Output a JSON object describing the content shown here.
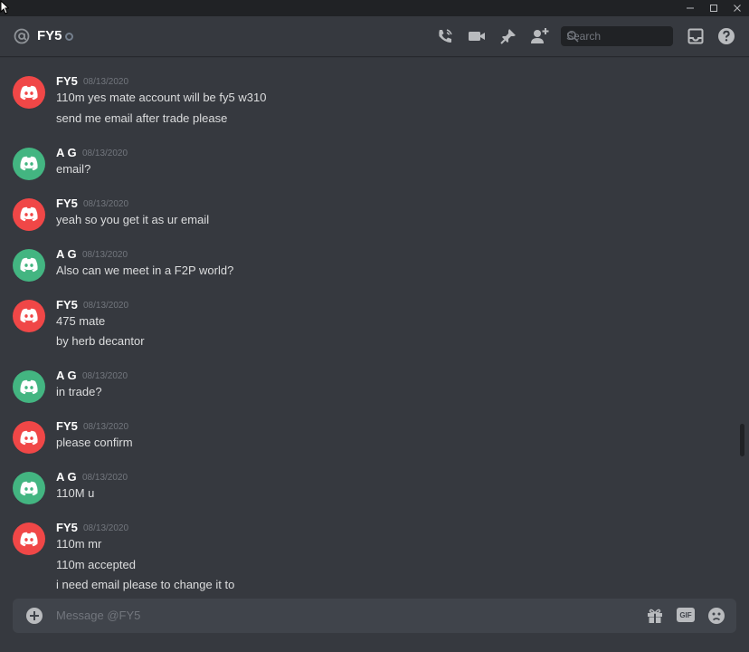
{
  "window": {
    "controls": [
      "minimize-icon",
      "maximize-icon",
      "close-icon"
    ]
  },
  "header": {
    "channel_name": "FY5",
    "status": "offline",
    "icons": [
      "call-icon",
      "video-icon",
      "pin-icon",
      "add-friend-icon",
      "inbox-icon",
      "help-icon"
    ],
    "search_placeholder": "Search"
  },
  "colors": {
    "fy5_avatar": "#f04747",
    "ag_avatar": "#43b581",
    "background": "#36393f",
    "header_text": "#ffffff"
  },
  "messages": [
    {
      "author": "FY5",
      "timestamp": "08/13/2020",
      "avatar": "red",
      "lines": [
        "110m yes mate account will be fy5 w310",
        "send me email after trade please"
      ]
    },
    {
      "author": "A G",
      "timestamp": "08/13/2020",
      "avatar": "green",
      "lines": [
        "email?"
      ]
    },
    {
      "author": "FY5",
      "timestamp": "08/13/2020",
      "avatar": "red",
      "lines": [
        "yeah so you get it as ur email"
      ]
    },
    {
      "author": "A G",
      "timestamp": "08/13/2020",
      "avatar": "green",
      "lines": [
        "Also can we meet in a F2P world?"
      ]
    },
    {
      "author": "FY5",
      "timestamp": "08/13/2020",
      "avatar": "red",
      "lines": [
        "475 mate",
        "by herb decantor"
      ]
    },
    {
      "author": "A G",
      "timestamp": "08/13/2020",
      "avatar": "green",
      "lines": [
        "in trade?"
      ]
    },
    {
      "author": "FY5",
      "timestamp": "08/13/2020",
      "avatar": "red",
      "lines": [
        "please confirm"
      ]
    },
    {
      "author": "A G",
      "timestamp": "08/13/2020",
      "avatar": "green",
      "lines": [
        "110M u"
      ]
    },
    {
      "author": "FY5",
      "timestamp": "08/13/2020",
      "avatar": "red",
      "lines": [
        "110m mr",
        "110m accepted",
        "i need email please to change it to"
      ]
    }
  ],
  "composer": {
    "placeholder": "Message @FY5",
    "gif_label": "GIF",
    "icons": [
      "add-attachment-icon",
      "gift-icon",
      "gif-icon",
      "emoji-icon"
    ]
  }
}
